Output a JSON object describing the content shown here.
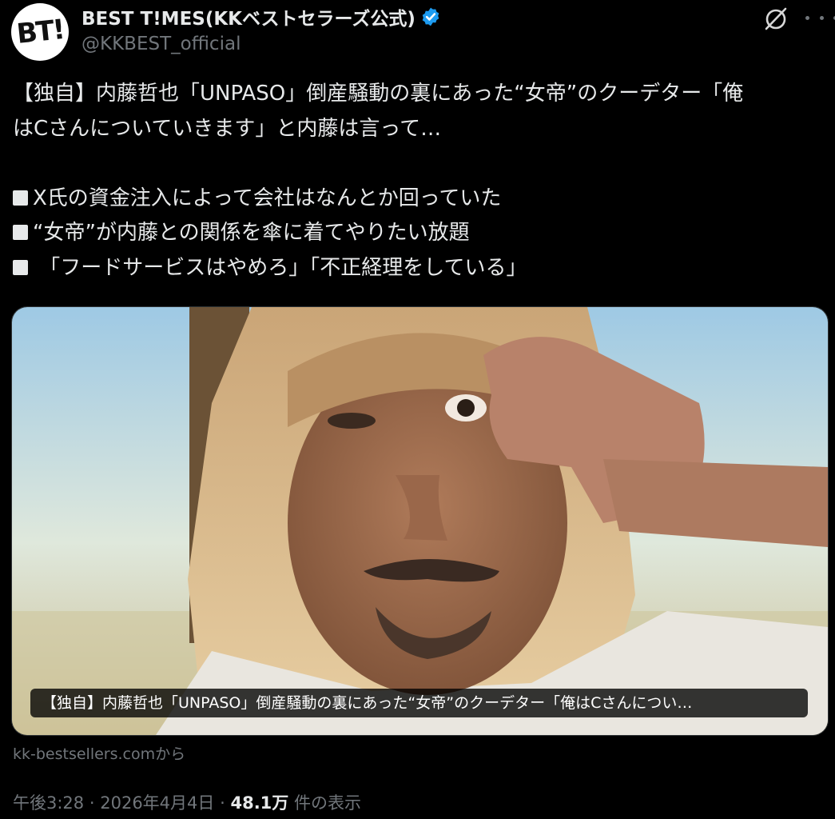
{
  "account": {
    "avatar_text": "BT!",
    "display_name": "BEST T!MES(KKベストセラーズ公式)",
    "handle": "@KKBEST_official"
  },
  "tweet": {
    "lines": [
      "【独自】内藤哲也「UNPASO」倒産騒動の裏にあった“女帝”のクーデター「俺",
      "はCさんについていきます」と内藤は言って…"
    ],
    "bullets": [
      "X氏の資金注入によって会社はなんとか回っていた",
      "“女帝”が内藤との関係を傘に着てやりたい放題",
      " 「フードサービスはやめろ」「不正経理をしている」"
    ]
  },
  "card": {
    "title": "【独自】内藤哲也「UNPASO」倒産騒動の裏にあった“女帝”のクーデター「俺はCさんについ…",
    "source": "kk-bestsellers.comから"
  },
  "meta": {
    "time": "午後3:28",
    "date": "2026年4月4日",
    "views": "48.1万",
    "views_label": "件の表示",
    "separator": "·"
  },
  "icons": [
    "verified-badge-icon",
    "grok-icon",
    "more-icon"
  ],
  "colors": {
    "background": "#000000",
    "text": "#e7e9ea",
    "muted": "#71767b",
    "verified": "#1d9bf0"
  }
}
